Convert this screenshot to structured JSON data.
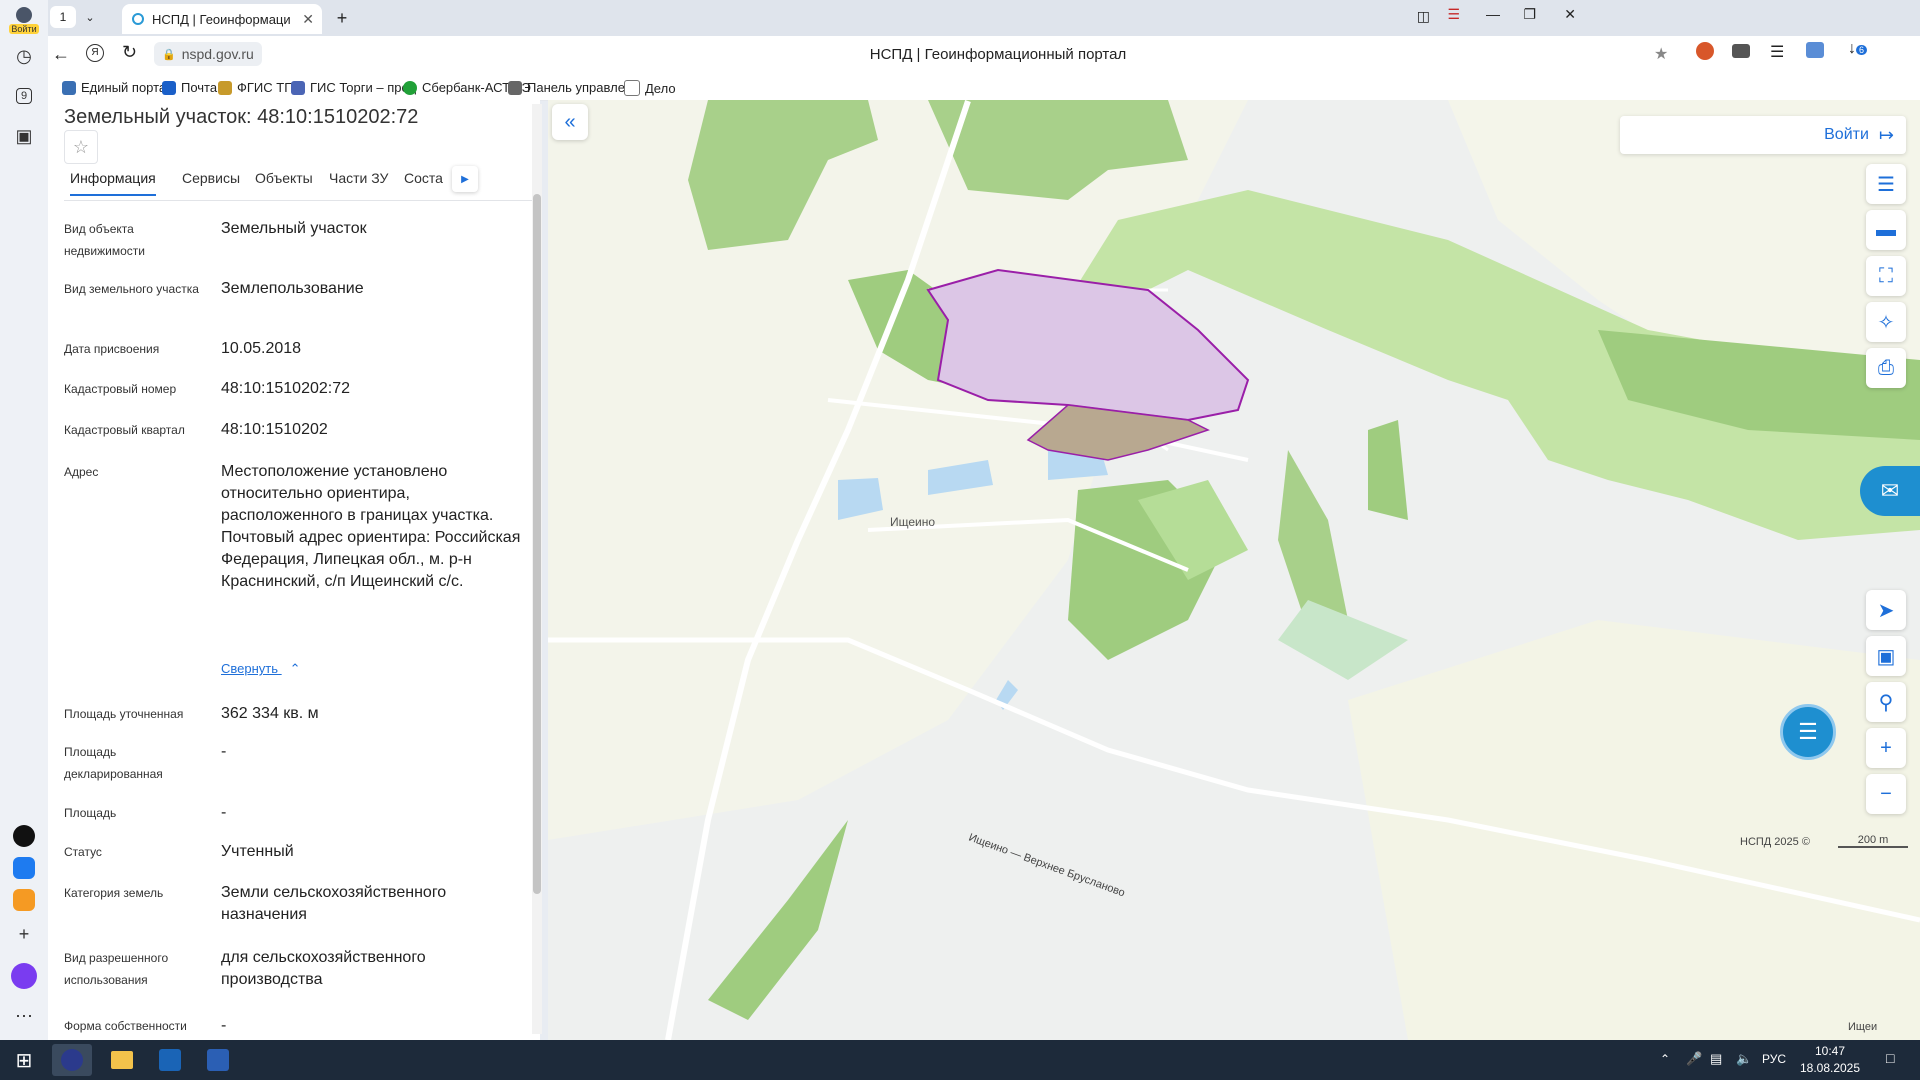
{
  "browser": {
    "tab_count": "1",
    "tab_title": "НСПД | Геоинформаци",
    "url": "nspd.gov.ru",
    "page_title": "НСПД | Геоинформационный портал",
    "user_label": "Войти",
    "side_badge": "9",
    "download_badge": "6",
    "bookmarks": [
      "Единый портал",
      "Почта",
      "ФГИС ТП",
      "ГИС Торги – прод",
      "Сбербанк-АСТ - Э",
      "Панель управлен",
      "Дело"
    ]
  },
  "panel": {
    "title": "Земельный участок: 48:10:1510202:72",
    "tabs": [
      "Информация",
      "Сервисы",
      "Объекты",
      "Части ЗУ",
      "Соста"
    ],
    "fields": [
      {
        "label": "Вид объекта недвижимости",
        "value": "Земельный участок"
      },
      {
        "label": "Вид земельного участка",
        "value": "Землепользование"
      },
      {
        "label": "Дата присвоения",
        "value": "10.05.2018"
      },
      {
        "label": "Кадастровый номер",
        "value": "48:10:1510202:72"
      },
      {
        "label": "Кадастровый квартал",
        "value": "48:10:1510202"
      },
      {
        "label": "Адрес",
        "value": "Местоположение установлено относительно ориентира, расположенного в границах участка. Почтовый адрес ориентира: Российская Федерация, Липецкая обл., м. р-н Краснинский, с/п Ищеинский с/с."
      },
      {
        "label": "Площадь уточненная",
        "value": "362 334 кв. м"
      },
      {
        "label": "Площадь декларированная",
        "value": "-"
      },
      {
        "label": "Площадь",
        "value": "-"
      },
      {
        "label": "Статус",
        "value": "Учтенный"
      },
      {
        "label": "Категория земель",
        "value": "Земли сельскохозяйственного назначения"
      },
      {
        "label": "Вид разрешенного использования",
        "value": "для сельскохозяйственного производства"
      },
      {
        "label": "Форма собственности",
        "value": "-"
      }
    ],
    "collapse_link": "Свернуть"
  },
  "map": {
    "login": "Войти",
    "village": "Ищеино",
    "road": "Ищеино — Верхнее Брусланово",
    "road2": "Ищеи",
    "attribution": "НСПД 2025 ©",
    "scale": "200 m",
    "colors": {
      "forest": "#9fcc7f",
      "meadow": "#c4e4a6",
      "water": "#b8d9f2",
      "parcel_stroke": "#9a1fa8",
      "parcel_fill": "#dcc6e6",
      "accent": "#1e6fd9"
    }
  },
  "taskbar": {
    "lang": "РУС",
    "time": "10:47",
    "date": "18.08.2025"
  }
}
